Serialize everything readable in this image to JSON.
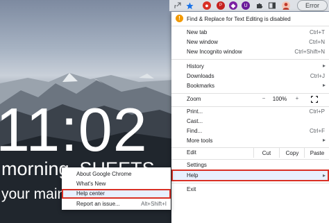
{
  "clock": {
    "time": "11:02"
  },
  "greeting": {
    "text": "morning, SHEETS"
  },
  "focus": {
    "text": "your main focus"
  },
  "toolbar": {
    "icons": [
      "share-icon",
      "bookmark-star-icon",
      "extension-red-icon",
      "extension-icon",
      "extension-icon",
      "extension-icon",
      "puzzle-icon",
      "sidebar-icon",
      "profile-avatar"
    ],
    "error_label": "Error"
  },
  "menu": {
    "warning": "Find & Replace for Text Editing is disabled",
    "new_tab": {
      "label": "New tab",
      "shortcut": "Ctrl+T"
    },
    "new_window": {
      "label": "New window",
      "shortcut": "Ctrl+N"
    },
    "new_incognito": {
      "label": "New Incognito window",
      "shortcut": "Ctrl+Shift+N"
    },
    "history": {
      "label": "History"
    },
    "downloads": {
      "label": "Downloads",
      "shortcut": "Ctrl+J"
    },
    "bookmarks": {
      "label": "Bookmarks"
    },
    "zoom": {
      "label": "Zoom",
      "minus": "−",
      "value": "100%",
      "plus": "+"
    },
    "print": {
      "label": "Print...",
      "shortcut": "Ctrl+P"
    },
    "cast": {
      "label": "Cast..."
    },
    "find": {
      "label": "Find...",
      "shortcut": "Ctrl+F"
    },
    "more_tools": {
      "label": "More tools"
    },
    "edit": {
      "label": "Edit",
      "cut": "Cut",
      "copy": "Copy",
      "paste": "Paste"
    },
    "settings": {
      "label": "Settings"
    },
    "help": {
      "label": "Help"
    },
    "exit": {
      "label": "Exit"
    }
  },
  "help_submenu": {
    "about": {
      "label": "About Google Chrome"
    },
    "whats_new": {
      "label": "What's New"
    },
    "help_center": {
      "label": "Help center"
    },
    "report": {
      "label": "Report an issue...",
      "shortcut": "Alt+Shift+I"
    }
  },
  "colors": {
    "accent": "#1a73e8",
    "highlight_border": "#d93025",
    "warning": "#f29900"
  }
}
